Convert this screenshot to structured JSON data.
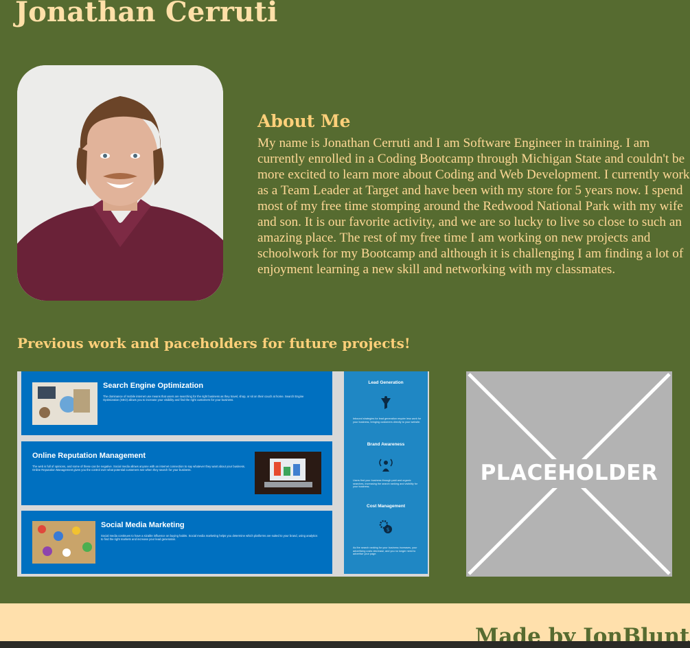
{
  "header": {
    "title": "Jonathan Cerruti"
  },
  "about": {
    "heading": "About Me",
    "text": "My name is Jonathan Cerruti and I am Software Engineer in training. I am currently enrolled in a Coding Bootcamp through Michigan State and couldn't be more excited to learn more about Coding and Web Development. I currently work as a Team Leader at Target and have been with my store for 5 years now. I spend most of my free time stomping around the Redwood National Park with my wife and son. It is our favorite activity, and we are so lucky to live so close to such an amazing place. The rest of my free time I am working on new projects and schoolwork for my Bootcamp and although it is challenging I am finding a lot of enjoyment learning a new skill and networking with my classmates."
  },
  "work": {
    "heading": "Previous work and paceholders for future projects!",
    "project1": {
      "services": [
        {
          "title": "Search Engine Optimization",
          "desc": "The dominance of mobile internet use means that users are searching for the right business as they travel, shop, or sit on their couch at home. Search Engine Optimization (SEO) allows you to increase your visibility and find the right customers for your business."
        },
        {
          "title": "Online Reputation Management",
          "desc": "The web is full of opinions, and some of these can be negative. Social media allows anyone with an internet connection to say whatever they want about your business. Online Reputation Management gives you the control over what potential customers see when they search for your business."
        },
        {
          "title": "Social Media Marketing",
          "desc": "Social media continues to have a sizable influence on buying habits. Social media marketing helps you determine which platforms are suited to your brand, using analytics to find the right markets and increase your lead generation."
        }
      ],
      "benefits": [
        {
          "title": "Lead Generation",
          "desc": "Inbound strategies for lead generation require less work for your business, bringing customers directly to your website."
        },
        {
          "title": "Brand Awareness",
          "desc": "Users find your business through paid and organic searches, increasing the search ranking and visibility for your business."
        },
        {
          "title": "Cost Management",
          "desc": "As the search ranking for your business increases, your advertising costs decrease, and you no longer need to advertise your page."
        }
      ]
    },
    "project2": {
      "label": "PLACEHOLDER"
    }
  },
  "footer": {
    "text": "Made by JonBluntIce"
  }
}
